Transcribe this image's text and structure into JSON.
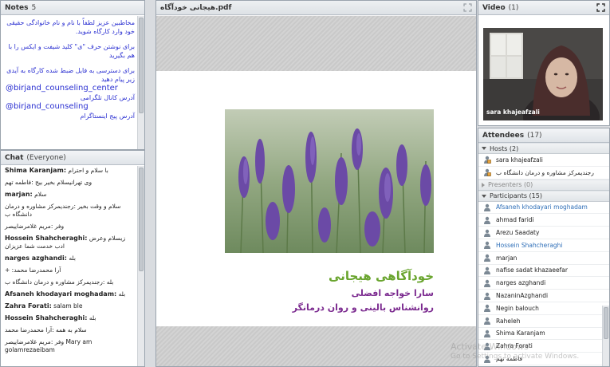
{
  "notes": {
    "title": "Notes",
    "count": "5",
    "lines": [
      "مخاطبین عزیز لطفاً با نام و نام خانوادگی حقیقی خود وارد کارگاه شوید.",
      "برای نوشتن حرف \"ی\" کلید شیفت و ایکس را با هم بگیرید",
      "برای دسترسی به فایل ضبط شده کارگاه به آیدی زیر پیام دهید"
    ],
    "handles": [
      {
        "handle": "@birjand_counseling_center",
        "desc": "آدرس کانال تلگرامی"
      },
      {
        "handle": "@birjand_counseling",
        "desc": "آدرس پیج اینستاگرام"
      }
    ]
  },
  "chat": {
    "title": "Chat",
    "scope": "(Everyone)",
    "messages": [
      {
        "sender": "Shima Karanjam:",
        "text": "با سلام و احترام"
      },
      {
        "sender": "",
        "text": "وی تهرانیسلام بخیر بیج :فاطمه تهم"
      },
      {
        "sender": "marjan:",
        "text": "سلام"
      },
      {
        "sender": "",
        "text": "سلام و وقت بخیر :رجندیمرکز مشاوره و درمان دانشگاه ب"
      },
      {
        "sender": "",
        "text": "وفر :مریم غلامرضاییصر"
      },
      {
        "sender": "Hossein Shahcheraghi:",
        "text": "زیسلام وعرض ادب خدمت شما عزیزان"
      },
      {
        "sender": "narges azghandi:",
        "text": "بله"
      },
      {
        "sender": "",
        "text": "+ :آرا محمدرضا محمد"
      },
      {
        "sender": "",
        "text": "بله :رجندیمرکز مشاوره و درمان دانشگاه ب"
      },
      {
        "sender": "Afsaneh khodayari moghadam:",
        "text": "بله"
      },
      {
        "sender": "Zahra Forati:",
        "text": "salam ble"
      },
      {
        "sender": "Hossein Shahcheraghi:",
        "text": "بله"
      },
      {
        "sender": "",
        "text": "سلام به همه :آرا محمدرضا محمد"
      },
      {
        "sender": "",
        "text": "وفر :مریم غلامرضاییصر Mary am golamrezaeibam"
      }
    ]
  },
  "document": {
    "filename": "هیجانی خودآگاه.pdf",
    "slide_title": "خودآگاهی هیجانی",
    "slide_line1": "سارا خواجه افضلی",
    "slide_line2": "روانشناس بالینی و روان درمانگر"
  },
  "video": {
    "title": "Video",
    "count": "(1)",
    "name": "sara khajeafzali"
  },
  "attendees": {
    "title": "Attendees",
    "count": "(17)",
    "hosts_label": "Hosts (2)",
    "hosts": [
      {
        "name": "sara khajeafzali"
      },
      {
        "name": "رجندیمرکز مشاوره و درمان دانشگاه ب"
      }
    ],
    "presenters_label": "Presenters (0)",
    "participants_label": "Participants (15)",
    "participants": [
      {
        "name": "Afsaneh khodayari moghadam",
        "highlight": true
      },
      {
        "name": "ahmad faridi",
        "highlight": false
      },
      {
        "name": "Arezu Saadaty",
        "highlight": false
      },
      {
        "name": "Hossein Shahcheraghi",
        "highlight": true
      },
      {
        "name": "marjan",
        "highlight": false
      },
      {
        "name": "nafise sadat khazaeefar",
        "highlight": false
      },
      {
        "name": "narges azghandi",
        "highlight": false
      },
      {
        "name": "NazaninAzghandi",
        "highlight": false
      },
      {
        "name": "Negin balouch",
        "highlight": false
      },
      {
        "name": "Raheleh",
        "highlight": false
      },
      {
        "name": "Shima Karanjam",
        "highlight": false
      },
      {
        "name": "Zahra Forati",
        "highlight": false
      },
      {
        "name": "فاطمه تهم",
        "highlight": false
      }
    ]
  },
  "watermark": {
    "line1": "Activate Windows",
    "line2": "Go to Settings to activate Windows."
  }
}
